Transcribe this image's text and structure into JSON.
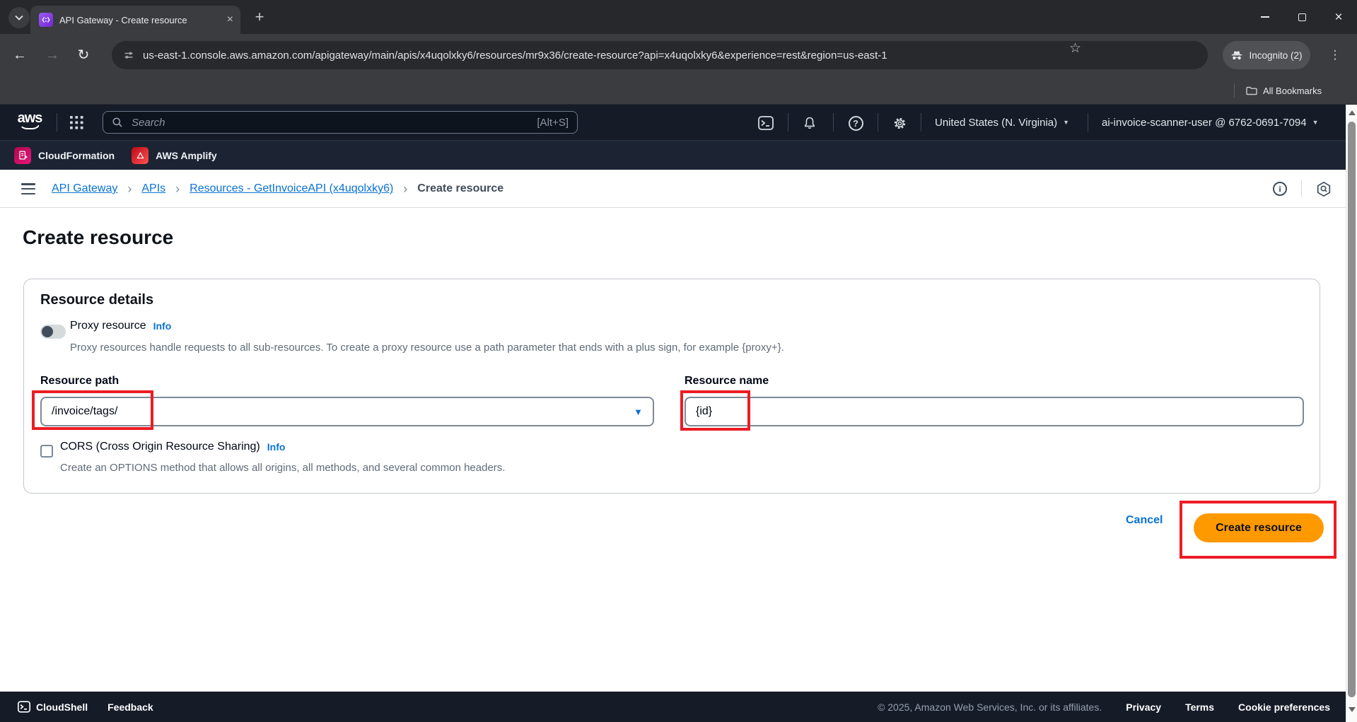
{
  "colors": {
    "aws_orange": "#ff9900",
    "link_blue": "#0972d3",
    "annotation_red": "#ed1c24",
    "aws_nav_dark": "#151c28",
    "chrome_toolbar": "#3a3c40",
    "tab_favicon_purple": "#7326d3"
  },
  "icons": {
    "close": "×",
    "plus": "+",
    "back": "←",
    "forward": "→",
    "reload": "↻",
    "star": "☆",
    "overflow_dots": "⋮",
    "caret_down": "▼",
    "question": "?",
    "info_i": "i",
    "breadcrumb_sep": "›"
  },
  "browser": {
    "tab_title": "API Gateway - Create resource",
    "url": "us-east-1.console.aws.amazon.com/apigateway/main/apis/x4uqolxky6/resources/mr9x36/create-resource?api=x4uqolxky6&experience=rest&region=us-east-1",
    "incognito_label": "Incognito (2)",
    "all_bookmarks": "All Bookmarks"
  },
  "nav": {
    "logo": "aws",
    "search_placeholder": "Search",
    "search_shortcut": "[Alt+S]",
    "region": "United States (N. Virginia)",
    "account": "ai-invoice-scanner-user @ 6762-0691-7094"
  },
  "favorites": {
    "cloudformation": "CloudFormation",
    "amplify": "AWS Amplify"
  },
  "breadcrumbs": [
    "API Gateway",
    "APIs",
    "Resources - GetInvoiceAPI (x4uqolxky6)",
    "Create resource"
  ],
  "page": {
    "title": "Create resource",
    "section_title": "Resource details",
    "proxy_label": "Proxy resource",
    "info_link": "Info",
    "proxy_description": "Proxy resources handle requests to all sub-resources. To create a proxy resource use a path parameter that ends with a plus sign, for example {proxy+}.",
    "path_label": "Resource path",
    "path_value": "/invoice/tags/",
    "name_label": "Resource name",
    "name_value": "{id}",
    "cors_label": "CORS (Cross Origin Resource Sharing)",
    "cors_description": "Create an OPTIONS method that allows all origins, all methods, and several common headers.",
    "cancel": "Cancel",
    "create": "Create resource"
  },
  "footer": {
    "cloudshell": "CloudShell",
    "feedback": "Feedback",
    "copyright": "© 2025, Amazon Web Services, Inc. or its affiliates.",
    "privacy": "Privacy",
    "terms": "Terms",
    "cookies": "Cookie preferences"
  }
}
